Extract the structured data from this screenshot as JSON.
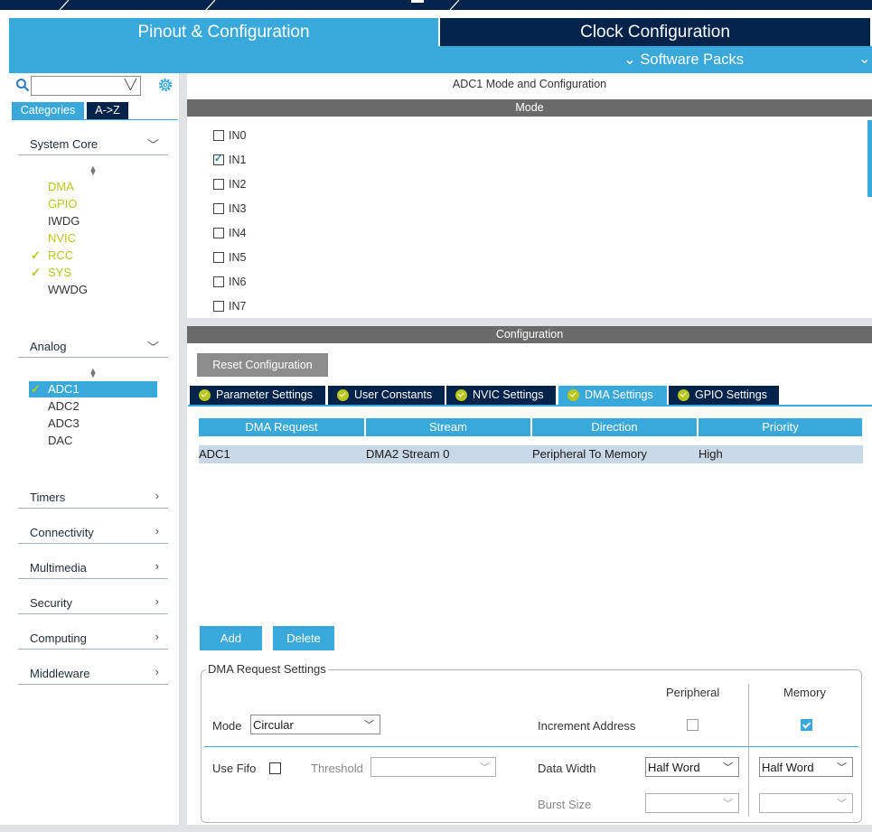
{
  "tabs": {
    "pinout": "Pinout & Configuration",
    "clock": "Clock Configuration",
    "software_packs": "Software Packs"
  },
  "colors": {
    "brand_light": "#39a9dc",
    "brand_dark": "#03234b",
    "accent_green": "#b9c61c",
    "section_grey": "#6a6a6a"
  },
  "left": {
    "search_value": "",
    "view_tabs": [
      "Categories",
      "A->Z"
    ],
    "system_core": {
      "label": "System Core",
      "items": [
        {
          "label": "DMA",
          "checked": false
        },
        {
          "label": "GPIO",
          "checked": false
        },
        {
          "label": "IWDG",
          "checked": false
        },
        {
          "label": "NVIC",
          "checked": false
        },
        {
          "label": "RCC",
          "checked": true
        },
        {
          "label": "SYS",
          "checked": true
        },
        {
          "label": "WWDG",
          "checked": false
        }
      ]
    },
    "analog": {
      "label": "Analog",
      "items": [
        {
          "label": "ADC1",
          "checked": true,
          "selected": true
        },
        {
          "label": "ADC2",
          "checked": false
        },
        {
          "label": "ADC3",
          "checked": false
        },
        {
          "label": "DAC",
          "checked": false
        }
      ]
    },
    "categories": [
      "Timers",
      "Connectivity",
      "Multimedia",
      "Security",
      "Computing",
      "Middleware"
    ]
  },
  "main": {
    "title": "ADC1 Mode and Configuration",
    "mode_header": "Mode",
    "mode_inputs": [
      {
        "label": "IN0",
        "checked": false
      },
      {
        "label": "IN1",
        "checked": true
      },
      {
        "label": "IN2",
        "checked": false
      },
      {
        "label": "IN3",
        "checked": false
      },
      {
        "label": "IN4",
        "checked": false
      },
      {
        "label": "IN5",
        "checked": false
      },
      {
        "label": "IN6",
        "checked": false
      },
      {
        "label": "IN7",
        "checked": false
      }
    ],
    "config_header": "Configuration",
    "reset_button": "Reset Configuration",
    "config_tabs": [
      "Parameter Settings",
      "User Constants",
      "NVIC Settings",
      "DMA Settings",
      "GPIO Settings"
    ],
    "active_config_tab": "DMA Settings",
    "dma_table": {
      "headers": [
        "DMA Request",
        "Stream",
        "Direction",
        "Priority"
      ],
      "rows": [
        [
          "ADC1",
          "DMA2 Stream 0",
          "Peripheral To Memory",
          "High"
        ]
      ]
    },
    "add_button": "Add",
    "delete_button": "Delete",
    "dma_request_settings": {
      "title": "DMA Request Settings",
      "peripheral_label": "Peripheral",
      "memory_label": "Memory",
      "mode_label": "Mode",
      "mode_value": "Circular",
      "increment_address_label": "Increment Address",
      "increment_peripheral": false,
      "increment_memory": true,
      "use_fifo_label": "Use Fifo",
      "use_fifo": false,
      "threshold_label": "Threshold",
      "threshold_value": "",
      "data_width_label": "Data Width",
      "data_width_peripheral": "Half Word",
      "data_width_memory": "Half Word",
      "burst_size_label": "Burst Size",
      "burst_peripheral": "",
      "burst_memory": ""
    }
  }
}
